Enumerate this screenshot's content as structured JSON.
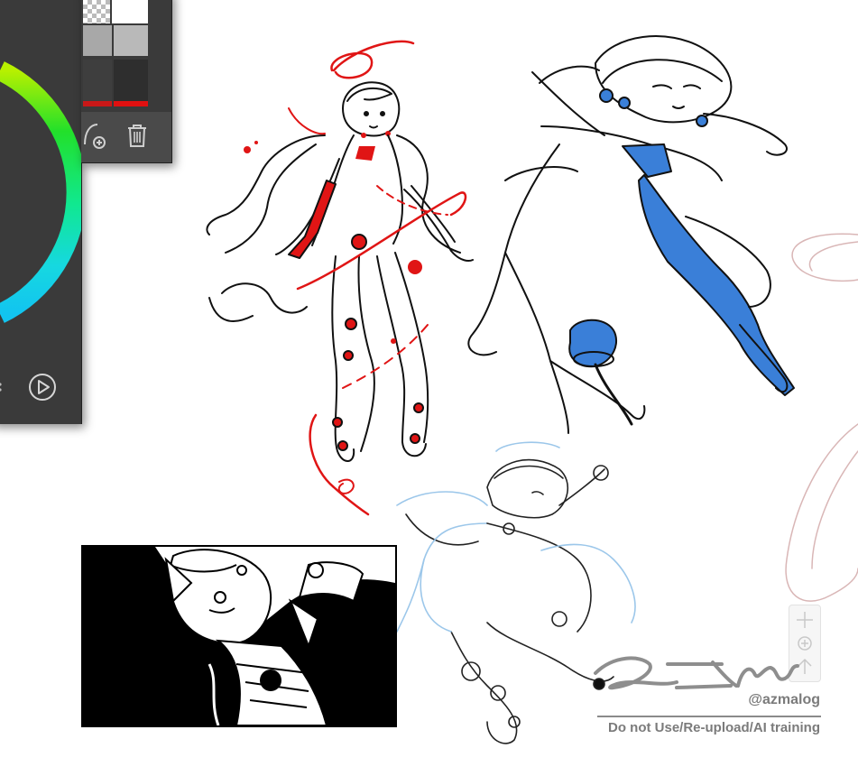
{
  "colors": {
    "panel_bg": "#3a3a3a",
    "panel_toolbar": "#4a4a4a",
    "sketch_red": "#e01515",
    "sketch_blue": "#3a7fd8",
    "ink": "#111111",
    "watermark": "#7b7b7b"
  },
  "color_panel": {
    "ring_label": "color-wheel",
    "play_icon": "play-circle-icon"
  },
  "layers_panel": {
    "swatches": [
      "transparent",
      "white",
      "grey",
      "grey",
      "dark-grey",
      "dark-grey",
      "red",
      "red"
    ],
    "toolbar": {
      "add_icon": "add-layer-icon",
      "delete_icon": "trash-icon"
    }
  },
  "nav_controls": {
    "items": [
      "crosshair-icon",
      "target-icon",
      "arrow-up-icon"
    ]
  },
  "watermark": {
    "handle": "@azmalog",
    "notice": "Do not Use/Re-upload/AI training"
  }
}
